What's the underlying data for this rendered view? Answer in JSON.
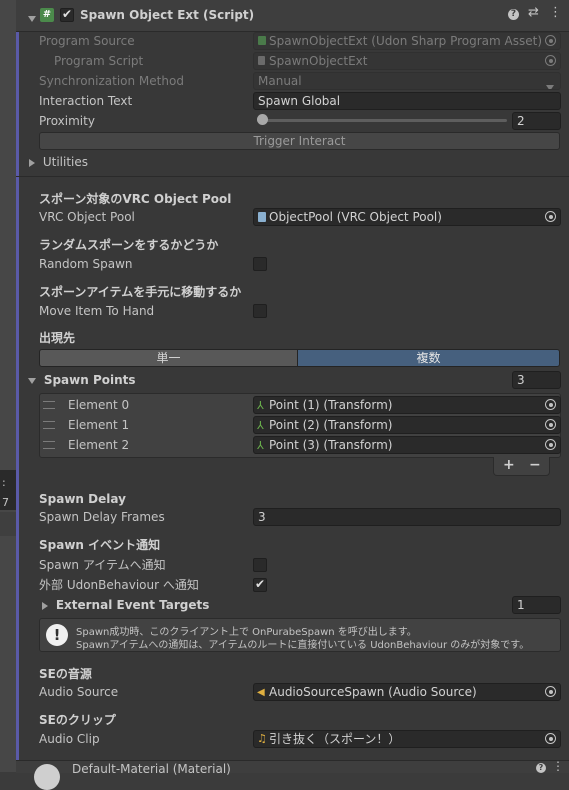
{
  "header": {
    "title": "Spawn Object Ext (Script)",
    "enabled": true
  },
  "left_strip": {
    "text_a": ":",
    "text_b": "7"
  },
  "fields": {
    "program_source": {
      "label": "Program Source",
      "value": "SpawnObjectExt (Udon Sharp Program Asset)"
    },
    "program_script": {
      "label": "Program Script",
      "value": "SpawnObjectExt"
    },
    "sync_method": {
      "label": "Synchronization Method",
      "value": "Manual"
    },
    "interaction_text": {
      "label": "Interaction Text",
      "value": "Spawn Global"
    },
    "proximity": {
      "label": "Proximity",
      "value": "2",
      "slider_fraction": 0.0
    },
    "trigger_interact": {
      "label": "Trigger Interact"
    },
    "utilities": {
      "label": "Utilities"
    }
  },
  "pool_section": {
    "heading": "スポーン対象のVRC Object Pool",
    "label": "VRC Object Pool",
    "value": "ObjectPool (VRC Object Pool)"
  },
  "random_section": {
    "heading": "ランダムスポーンをするかどうか",
    "label": "Random Spawn",
    "checked": false
  },
  "hand_section": {
    "heading": "スポーンアイテムを手元に移動するか",
    "label": "Move Item To Hand",
    "checked": false
  },
  "spawn_target": {
    "heading": "出現先",
    "options": [
      "単一",
      "複数"
    ],
    "selected": "複数"
  },
  "spawn_points": {
    "label": "Spawn Points",
    "size": "3",
    "elements": [
      {
        "label": "Element 0",
        "value": "Point (1) (Transform)"
      },
      {
        "label": "Element 1",
        "value": "Point (2) (Transform)"
      },
      {
        "label": "Element 2",
        "value": "Point (3) (Transform)"
      }
    ],
    "add_label": "+",
    "remove_label": "−"
  },
  "spawn_delay": {
    "heading": "Spawn Delay",
    "label": "Spawn Delay Frames",
    "value": "3"
  },
  "events": {
    "heading": "Spawn イベント通知",
    "notify_item_label": "Spawn アイテムへ通知",
    "notify_item_checked": false,
    "notify_external_label": "外部 UdonBehaviour へ通知",
    "notify_external_checked": true,
    "external_targets_label": "External Event Targets",
    "external_targets_size": "1",
    "help_line1": "Spawn成功時、このクライアント上で OnPurabeSpawn を呼び出します。",
    "help_line2": "Spawnアイテムへの通知は、アイテムのルートに直接付いている UdonBehaviour のみが対象です。"
  },
  "audio_source": {
    "heading": "SEの音源",
    "label": "Audio Source",
    "value": "AudioSourceSpawn (Audio Source)"
  },
  "audio_clip": {
    "heading": "SEのクリップ",
    "label": "Audio Clip",
    "value": "引き抜く（スポーン！）"
  },
  "bottom": {
    "title": "Default-Material (Material)"
  },
  "colors": {
    "accent": "#4a6b8a",
    "panel": "#383838",
    "border_accent": "#5a5aa8"
  }
}
